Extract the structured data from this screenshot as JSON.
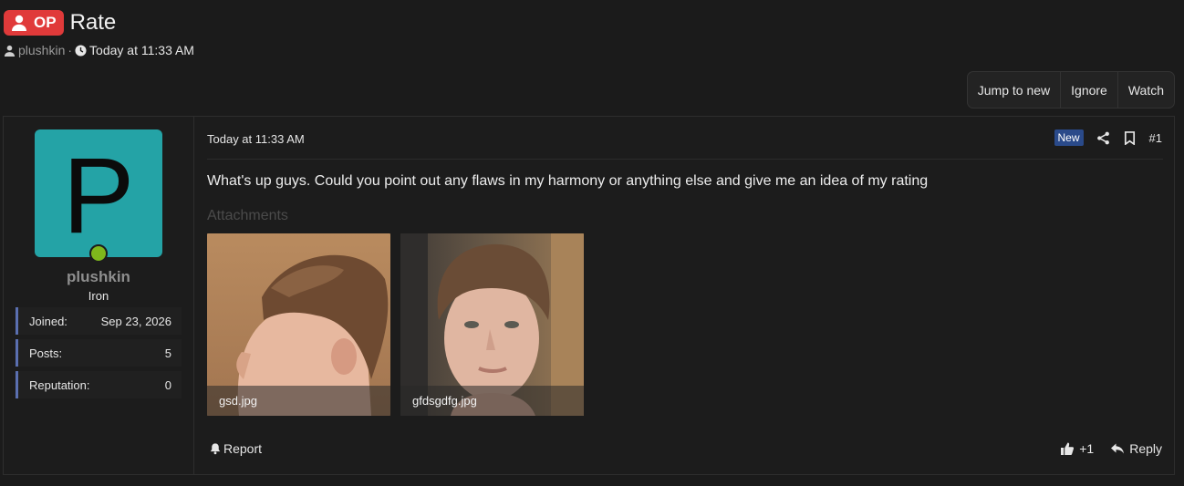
{
  "thread": {
    "badge": "OP",
    "title": "Rate",
    "author": "plushkin",
    "separator": "·",
    "date": "Today at 11:33 AM"
  },
  "actions": [
    "Jump to new",
    "Ignore",
    "Watch"
  ],
  "user": {
    "avatar_letter": "P",
    "avatar_color": "#24a3a6",
    "online_color": "#7fb81c",
    "name": "plushkin",
    "rank": "Iron",
    "stats": [
      {
        "label": "Joined:",
        "value": "Sep 23, 2026"
      },
      {
        "label": "Posts:",
        "value": "5"
      },
      {
        "label": "Reputation:",
        "value": "0"
      }
    ]
  },
  "post": {
    "date": "Today at 11:33 AM",
    "new_label": "New",
    "number": "#1",
    "message": "What's up guys. Could you point out any flaws in my harmony or anything else and give me an idea of my rating",
    "attachments_label": "Attachments",
    "attachments": [
      {
        "filename": "gsd.jpg"
      },
      {
        "filename": "gfdsgdfg.jpg"
      }
    ],
    "report_label": "Report",
    "like_count": "+1",
    "reply_label": "Reply"
  },
  "colors": {
    "op_badge": "#e03a3a",
    "new_badge": "#2a4a8a",
    "stat_accent": "#5a6fb0"
  }
}
